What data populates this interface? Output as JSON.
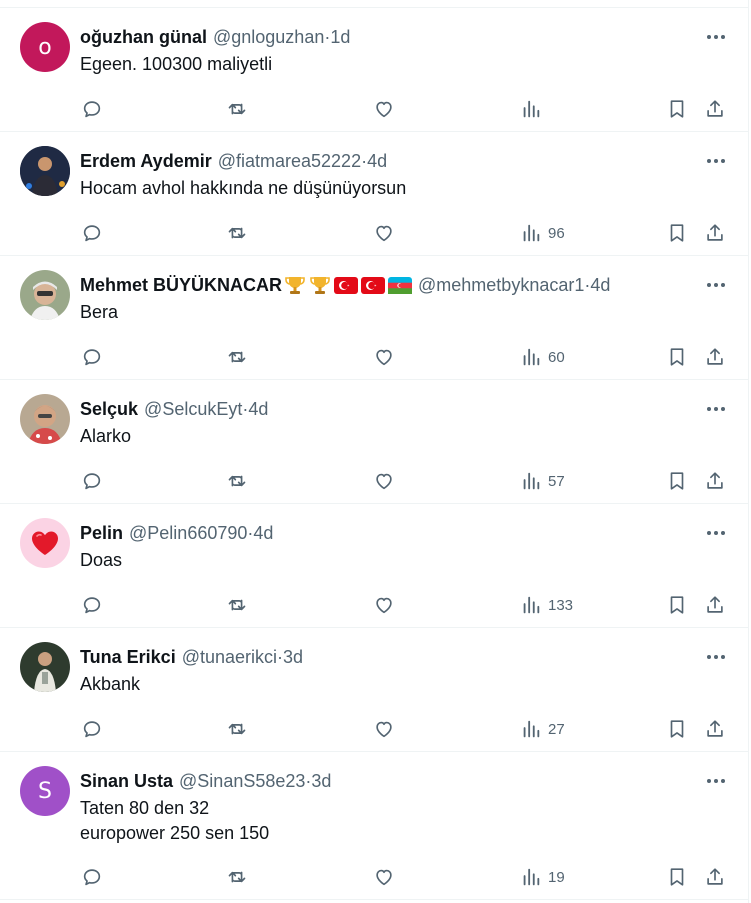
{
  "posts": [
    {
      "name": "oğuzhan günal",
      "handle": "@gnloguzhan",
      "time": "1d",
      "text": "Egeen. 100300 maliyetli",
      "views": "",
      "avatar_letter": "o",
      "avatar_bg": "#c2185b"
    },
    {
      "name": "Erdem Aydemir",
      "handle": "@fiatmarea52222",
      "time": "4d",
      "text": "Hocam avhol hakkında ne düşünüyorsun",
      "views": "96",
      "avatar_letter": "",
      "avatar_bg": "#1f2a44"
    },
    {
      "name": "Mehmet BÜYÜKNACAR",
      "handle": "@mehmetbyknacar1",
      "time": "4d",
      "text": "Bera",
      "views": "60",
      "avatar_letter": "",
      "avatar_bg": "#8d9a78"
    },
    {
      "name": "Selçuk",
      "handle": "@SelcukEyt",
      "time": "4d",
      "text": "Alarko",
      "views": "57",
      "avatar_letter": "",
      "avatar_bg": "#9e8d7d"
    },
    {
      "name": "Pelin",
      "handle": "@Pelin660790",
      "time": "4d",
      "text": "Doas",
      "views": "133",
      "avatar_letter": "",
      "avatar_bg": "#f8c8dc"
    },
    {
      "name": "Tuna Erikci",
      "handle": "@tunaerikci",
      "time": "3d",
      "text": "Akbank",
      "views": "27",
      "avatar_letter": "",
      "avatar_bg": "#3a4a3a"
    },
    {
      "name": "Sinan Usta",
      "handle": "@SinanS58e23",
      "time": "3d",
      "text": "Taten 80 den 32\neuropower 250 sen 150",
      "views": "19",
      "avatar_letter": "S",
      "avatar_bg": "#a050c8"
    }
  ],
  "separator": " · ",
  "colors": {
    "text": "#0f1419",
    "muted": "#536471",
    "border": "#eff3f4"
  }
}
